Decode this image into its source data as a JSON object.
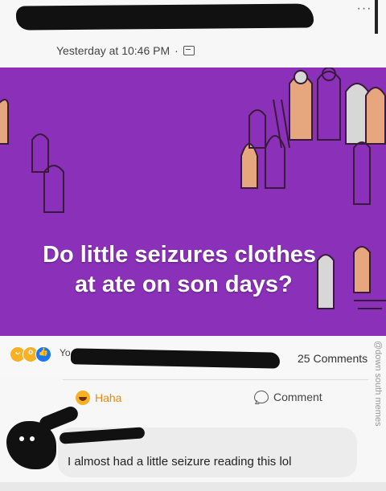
{
  "header": {
    "timestamp": "Yesterday at 10:46 PM",
    "separator": "·",
    "more_label": "···"
  },
  "image": {
    "headline_line1": "Do little seizures clothes",
    "headline_line2": "at ate on son days?",
    "background_color": "#8b31b9"
  },
  "stats": {
    "reactions": [
      "haha-icon",
      "wow-icon",
      "like-icon"
    ],
    "reactor_prefix": "Yo",
    "comments_count": "25 Comments"
  },
  "actions": {
    "haha_label": "Haha",
    "comment_label": "Comment"
  },
  "comment": {
    "text": "I almost had a little seizure reading this lol"
  },
  "watermark": {
    "text": "@down south memes"
  }
}
